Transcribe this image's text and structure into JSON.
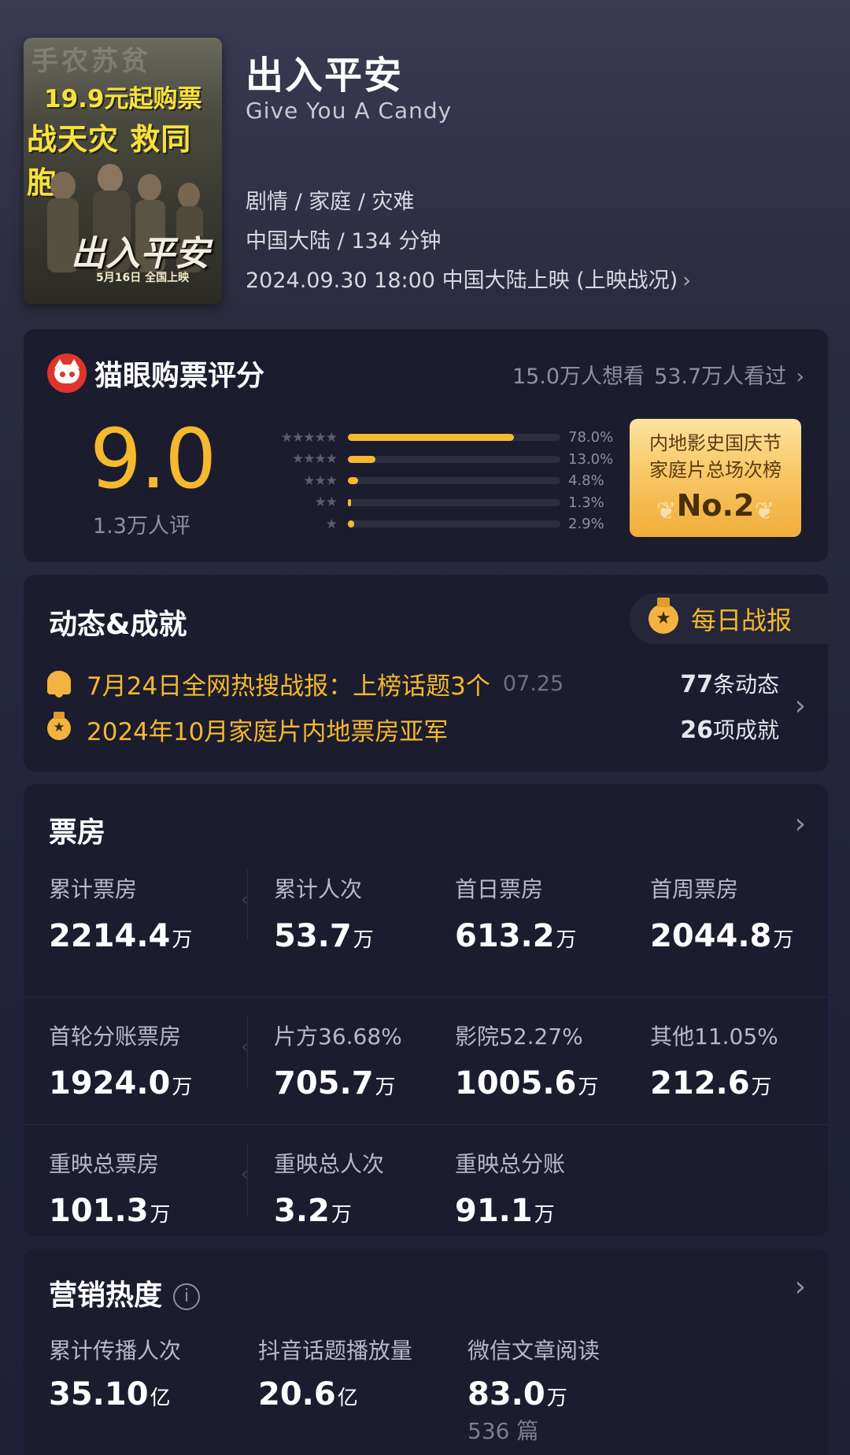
{
  "poster": {
    "top_text": "手农苏贫",
    "line1": "19.9元起购票",
    "line2": "战天灾 救同胞",
    "title_art": "出入平安",
    "date": "5月16日 全国上映"
  },
  "movie": {
    "title": "出入平安",
    "english_title": "Give You A Candy",
    "genres": "剧情 / 家庭 / 灾难",
    "region_duration": "中国大陆 / 134 分钟",
    "release": "2024.09.30 18:00 中国大陆上映 (上映战况)",
    "release_chevron": "›"
  },
  "rating": {
    "title": "猫眼购票评分",
    "want_to_watch": "15.0万人想看",
    "watched": "53.7万人看过",
    "chevron": "›",
    "score": "9.0",
    "rater_count": "1.3万人评",
    "distribution": [
      {
        "stars": "★★★★★",
        "fraction": 0.78,
        "label": "78.0%"
      },
      {
        "stars": "★★★★",
        "fraction": 0.13,
        "label": "13.0%"
      },
      {
        "stars": "★★★",
        "fraction": 0.048,
        "label": "4.8%"
      },
      {
        "stars": "★★",
        "fraction": 0.013,
        "label": "1.3%"
      },
      {
        "stars": "★",
        "fraction": 0.029,
        "label": "2.9%"
      }
    ],
    "rank": {
      "line1": "内地影史国庆节",
      "line2": "家庭片总场次榜",
      "position": "No.2"
    }
  },
  "dynamics": {
    "title": "动态&成就",
    "daily_report": "每日战报",
    "items": [
      {
        "icon": "bell-icon",
        "text": "7月24日全网热搜战报：上榜话题3个",
        "date": "07.25"
      },
      {
        "icon": "medal-icon",
        "text": "2024年10月家庭片内地票房亚军",
        "date": ""
      }
    ],
    "dynamic_count": "77",
    "dynamic_label": "条动态",
    "achievement_count": "26",
    "achievement_label": "项成就",
    "chevron": "›"
  },
  "box_office": {
    "title": "票房",
    "chevron": "›",
    "rows": [
      [
        {
          "label": "累计票房",
          "value": "2214.4",
          "unit": "万"
        },
        {
          "label": "累计人次",
          "value": "53.7",
          "unit": "万"
        },
        {
          "label": "首日票房",
          "value": "613.2",
          "unit": "万"
        },
        {
          "label": "首周票房",
          "value": "2044.8",
          "unit": "万"
        }
      ],
      [
        {
          "label": "首轮分账票房",
          "value": "1924.0",
          "unit": "万"
        },
        {
          "label": "片方36.68%",
          "value": "705.7",
          "unit": "万"
        },
        {
          "label": "影院52.27%",
          "value": "1005.6",
          "unit": "万"
        },
        {
          "label": "其他11.05%",
          "value": "212.6",
          "unit": "万"
        }
      ],
      [
        {
          "label": "重映总票房",
          "value": "101.3",
          "unit": "万"
        },
        {
          "label": "重映总人次",
          "value": "3.2",
          "unit": "万"
        },
        {
          "label": "重映总分账",
          "value": "91.1",
          "unit": "万"
        }
      ]
    ]
  },
  "marketing": {
    "title": "营销热度",
    "info_glyph": "i",
    "chevron": "›",
    "items": [
      {
        "label": "累计传播人次",
        "value": "35.10",
        "unit": "亿",
        "sub": ""
      },
      {
        "label": "抖音话题播放量",
        "value": "20.6",
        "unit": "亿",
        "sub": ""
      },
      {
        "label": "微信文章阅读",
        "value": "83.0",
        "unit": "万",
        "sub": "536 篇"
      }
    ]
  },
  "colors": {
    "accent": "#f5b82e",
    "card_bg": "#1b1c2e",
    "brand_red": "#e0342d"
  }
}
